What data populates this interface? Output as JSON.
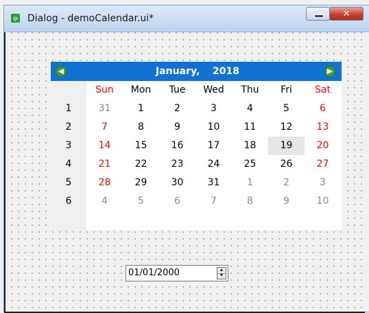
{
  "window": {
    "title": "Dialog - demoCalendar.ui*",
    "minimize_label": "",
    "close_label": "✕",
    "app_icon_glyph": "Qt"
  },
  "calendar": {
    "month": "January,",
    "year": "2018",
    "prev_icon": "◀",
    "next_icon": "▶",
    "headers": [
      "Sun",
      "Mon",
      "Tue",
      "Wed",
      "Thu",
      "Fri",
      "Sat"
    ],
    "week_numbers": [
      "1",
      "2",
      "3",
      "4",
      "5",
      "6"
    ],
    "weeks": [
      [
        "31",
        "1",
        "2",
        "3",
        "4",
        "5",
        "6"
      ],
      [
        "7",
        "8",
        "9",
        "10",
        "11",
        "12",
        "13"
      ],
      [
        "14",
        "15",
        "16",
        "17",
        "18",
        "19",
        "20"
      ],
      [
        "21",
        "22",
        "23",
        "24",
        "25",
        "26",
        "27"
      ],
      [
        "28",
        "29",
        "30",
        "31",
        "1",
        "2",
        "3"
      ],
      [
        "4",
        "5",
        "6",
        "7",
        "8",
        "9",
        "10"
      ]
    ],
    "selected_date": "19",
    "colors": {
      "nav_bg": "#1073d4",
      "weekend": "#ff0000",
      "other_month": "#8c8c8c",
      "selected_bg": "#e6e6e6"
    }
  },
  "date_edit": {
    "value": "01/01/2000"
  }
}
